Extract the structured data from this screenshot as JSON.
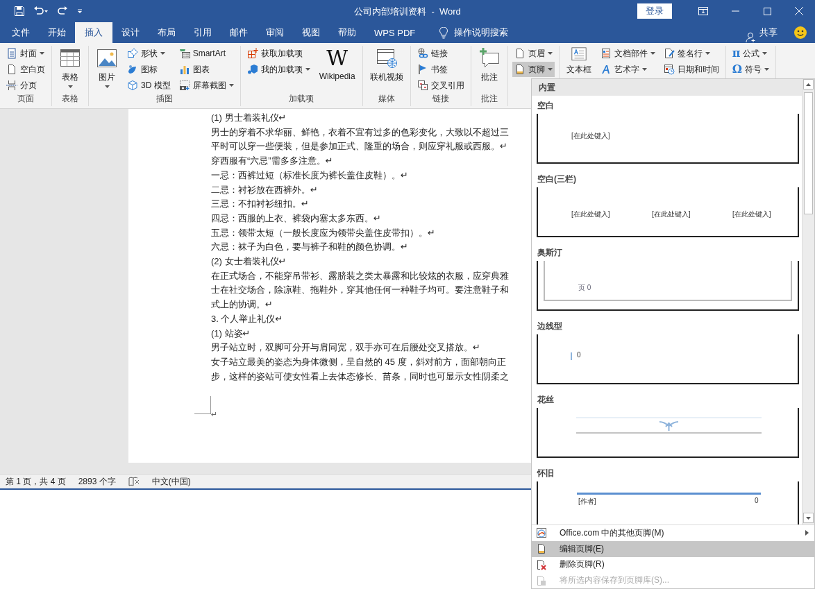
{
  "title_bar": {
    "title": "公司内部培训资料  -  Word",
    "login": "登录"
  },
  "tabs": [
    {
      "label": "文件",
      "selected": false
    },
    {
      "label": "开始",
      "selected": false
    },
    {
      "label": "插入",
      "selected": true
    },
    {
      "label": "设计",
      "selected": false
    },
    {
      "label": "布局",
      "selected": false
    },
    {
      "label": "引用",
      "selected": false
    },
    {
      "label": "邮件",
      "selected": false
    },
    {
      "label": "审阅",
      "selected": false
    },
    {
      "label": "视图",
      "selected": false
    },
    {
      "label": "帮助",
      "selected": false
    },
    {
      "label": "WPS PDF",
      "selected": false
    }
  ],
  "tell_me": "操作说明搜索",
  "share": "共享",
  "ribbon": {
    "groups": [
      {
        "label": "页面",
        "columns": [
          [
            {
              "kind": "small",
              "label": "封面",
              "menu": true
            },
            {
              "kind": "small",
              "label": "空白页",
              "menu": false
            },
            {
              "kind": "small",
              "label": "分页",
              "menu": false
            }
          ]
        ]
      },
      {
        "label": "表格",
        "columns": [
          [
            {
              "kind": "large",
              "label": "表格",
              "menu": true
            }
          ]
        ]
      },
      {
        "label": "插图",
        "columns": [
          [
            {
              "kind": "large",
              "label": "图片",
              "menu": true
            }
          ],
          [
            {
              "kind": "small",
              "label": "形状",
              "menu": true
            },
            {
              "kind": "small",
              "label": "图标",
              "menu": false
            },
            {
              "kind": "small",
              "label": "3D 模型",
              "menu": false
            }
          ],
          [
            {
              "kind": "small",
              "label": "SmartArt",
              "menu": false
            },
            {
              "kind": "small",
              "label": "图表",
              "menu": false
            },
            {
              "kind": "small",
              "label": "屏幕截图",
              "menu": true
            }
          ]
        ]
      },
      {
        "label": "加载项",
        "columns": [
          [
            {
              "kind": "small",
              "label": "获取加载项",
              "menu": false
            },
            {
              "kind": "small",
              "label": "我的加载项",
              "menu": true
            }
          ],
          [
            {
              "kind": "large",
              "label": "Wikipedia",
              "glyph": "W",
              "menu": false
            }
          ]
        ]
      },
      {
        "label": "媒体",
        "columns": [
          [
            {
              "kind": "large",
              "label": "联机视频",
              "menu": false
            }
          ]
        ]
      },
      {
        "label": "链接",
        "columns": [
          [
            {
              "kind": "small",
              "label": "链接",
              "menu": false
            },
            {
              "kind": "small",
              "label": "书签",
              "menu": false
            },
            {
              "kind": "small",
              "label": "交叉引用",
              "menu": false
            }
          ]
        ]
      },
      {
        "label": "批注",
        "columns": [
          [
            {
              "kind": "large",
              "label": "批注",
              "menu": false
            }
          ]
        ]
      },
      {
        "columns": [
          [
            {
              "kind": "small",
              "label": "页眉",
              "menu": true,
              "selected": false
            },
            {
              "kind": "small",
              "label": "页脚",
              "menu": true,
              "selected": true
            }
          ]
        ]
      },
      {
        "columns": [
          [
            {
              "kind": "large",
              "label": "文本框",
              "menu": false
            }
          ],
          [
            {
              "kind": "small",
              "label": "文档部件",
              "menu": true
            },
            {
              "kind": "small",
              "label": "艺术字",
              "menu": true
            }
          ],
          [
            {
              "kind": "small",
              "label": "签名行",
              "menu": true
            },
            {
              "kind": "small",
              "label": "日期和时间",
              "menu": false
            }
          ]
        ]
      },
      {
        "columns": [
          [
            {
              "kind": "small",
              "label": "公式",
              "glyph": "π",
              "menu": true
            },
            {
              "kind": "small",
              "label": "符号",
              "glyph": "Ω",
              "menu": true
            }
          ]
        ]
      }
    ]
  },
  "document": {
    "lines": [
      "(1) 男士着装礼仪↵",
      "男士的穿着不求华丽、鲜艳，衣着不宜有过多的色彩变化，大致以不超过三",
      "平时可以穿一些便装，但是参加正式、隆重的场合，则应穿礼服或西服。↵",
      "穿西服有“六忌”需多多注意。↵",
      "一忌：西裤过短（标准长度为裤长盖住皮鞋）。↵",
      "二忌：衬衫放在西裤外。↵",
      "三忌：不扣衬衫纽扣。↵",
      "四忌：西服的上衣、裤袋内塞太多东西。↵",
      "五忌：领带太短（一般长度应为领带尖盖住皮带扣）。↵",
      "六忌：袜子为白色，要与裤子和鞋的颜色协调。↵",
      "(2) 女士着装礼仪↵",
      "在正式场合，不能穿吊带衫、露脐装之类太暴露和比较炫的衣服，应穿典雅",
      "士在社交场合，除凉鞋、拖鞋外，穿其他任何一种鞋子均可。要注意鞋子和",
      "式上的协调。↵",
      "3. 个人举止礼仪↵",
      "(1) 站姿↵",
      "男子站立时，双脚可分开与肩同宽，双手亦可在后腰处交叉搭放。↵",
      "女子站立最美的姿态为身体微侧，呈自然的 45 度，斜对前方，面部朝向正",
      "步，这样的姿站可使女性看上去体态修长、苗条，同时也可显示女性阴柔之"
    ],
    "end_mark": "↵"
  },
  "status_bar": {
    "page": "第 1 页，共 4 页",
    "words": "2893 个字",
    "language": "中文(中国)"
  },
  "footer_menu": {
    "section": "内置",
    "gallery": [
      {
        "name": "空白",
        "kind": "blank",
        "texts": [
          "[在此处键入]"
        ]
      },
      {
        "name": "空白(三栏)",
        "kind": "three_column",
        "texts": [
          "[在此处键入]",
          "[在此处键入]",
          "[在此处键入]"
        ]
      },
      {
        "name": "奥斯汀",
        "kind": "austin",
        "texts": [
          "页 0"
        ]
      },
      {
        "name": "边线型",
        "kind": "sideline",
        "texts": [
          "0"
        ]
      },
      {
        "name": "花丝",
        "kind": "filigree"
      },
      {
        "name": "怀旧",
        "kind": "retro",
        "texts": [
          "[作者]",
          "0"
        ]
      }
    ],
    "items": [
      {
        "label": "Office.com 中的其他页脚(M)",
        "kind": "submenu",
        "selected": false,
        "disabled": false
      },
      {
        "label": "编辑页脚(E)",
        "kind": "edit",
        "selected": true,
        "disabled": false
      },
      {
        "label": "删除页脚(R)",
        "kind": "remove",
        "selected": false,
        "disabled": false
      },
      {
        "label": "将所选内容保存到页脚库(S)...",
        "kind": "save",
        "selected": false,
        "disabled": true
      }
    ]
  }
}
